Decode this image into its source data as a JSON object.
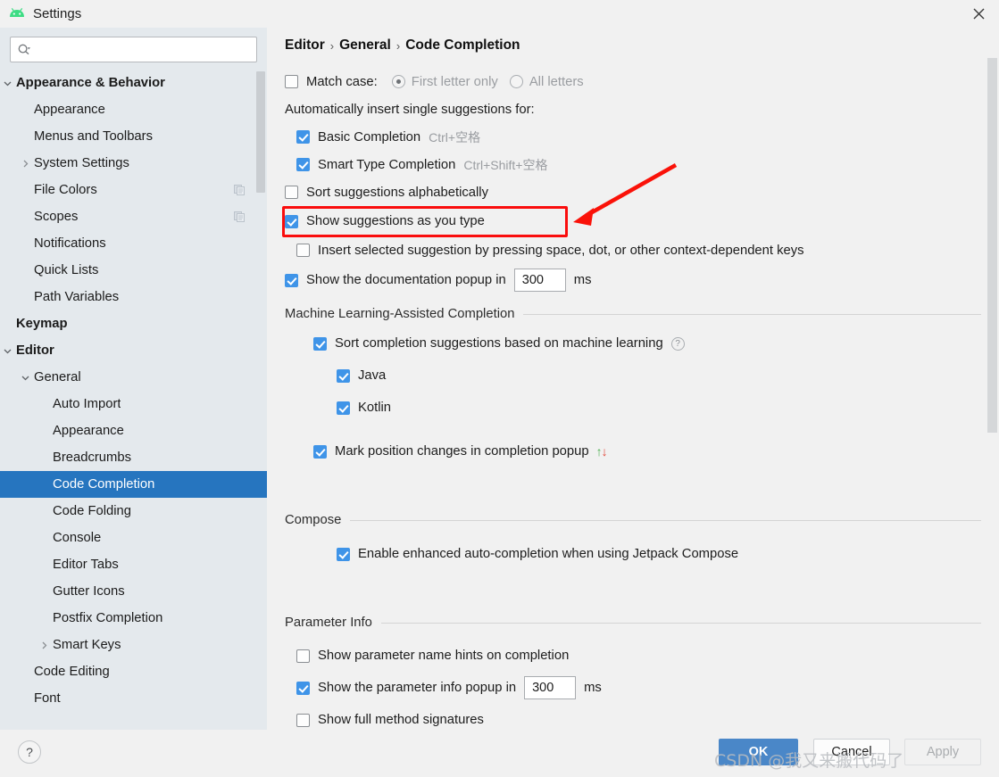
{
  "window": {
    "title": "Settings",
    "app_icon": "android-studio-icon",
    "close_icon": "close-icon"
  },
  "sidebar": {
    "search": {
      "value": "",
      "placeholder": "",
      "icon": "search-icon"
    },
    "items": [
      {
        "label": "Appearance & Behavior",
        "indent": 0,
        "bold": true,
        "twisty": "chevron-down",
        "selected": false,
        "trailing": ""
      },
      {
        "label": "Appearance",
        "indent": 1,
        "bold": false,
        "twisty": "",
        "selected": false,
        "trailing": ""
      },
      {
        "label": "Menus and Toolbars",
        "indent": 1,
        "bold": false,
        "twisty": "",
        "selected": false,
        "trailing": ""
      },
      {
        "label": "System Settings",
        "indent": 1,
        "bold": false,
        "twisty": "chevron-right",
        "selected": false,
        "trailing": ""
      },
      {
        "label": "File Colors",
        "indent": 1,
        "bold": false,
        "twisty": "",
        "selected": false,
        "trailing": "copy-icon"
      },
      {
        "label": "Scopes",
        "indent": 1,
        "bold": false,
        "twisty": "",
        "selected": false,
        "trailing": "copy-icon"
      },
      {
        "label": "Notifications",
        "indent": 1,
        "bold": false,
        "twisty": "",
        "selected": false,
        "trailing": ""
      },
      {
        "label": "Quick Lists",
        "indent": 1,
        "bold": false,
        "twisty": "",
        "selected": false,
        "trailing": ""
      },
      {
        "label": "Path Variables",
        "indent": 1,
        "bold": false,
        "twisty": "",
        "selected": false,
        "trailing": ""
      },
      {
        "label": "Keymap",
        "indent": 0,
        "bold": true,
        "twisty": "",
        "selected": false,
        "trailing": ""
      },
      {
        "label": "Editor",
        "indent": 0,
        "bold": true,
        "twisty": "chevron-down",
        "selected": false,
        "trailing": ""
      },
      {
        "label": "General",
        "indent": 1,
        "bold": false,
        "twisty": "chevron-down",
        "selected": false,
        "trailing": ""
      },
      {
        "label": "Auto Import",
        "indent": 2,
        "bold": false,
        "twisty": "",
        "selected": false,
        "trailing": ""
      },
      {
        "label": "Appearance",
        "indent": 2,
        "bold": false,
        "twisty": "",
        "selected": false,
        "trailing": ""
      },
      {
        "label": "Breadcrumbs",
        "indent": 2,
        "bold": false,
        "twisty": "",
        "selected": false,
        "trailing": ""
      },
      {
        "label": "Code Completion",
        "indent": 2,
        "bold": false,
        "twisty": "",
        "selected": true,
        "trailing": ""
      },
      {
        "label": "Code Folding",
        "indent": 2,
        "bold": false,
        "twisty": "",
        "selected": false,
        "trailing": ""
      },
      {
        "label": "Console",
        "indent": 2,
        "bold": false,
        "twisty": "",
        "selected": false,
        "trailing": ""
      },
      {
        "label": "Editor Tabs",
        "indent": 2,
        "bold": false,
        "twisty": "",
        "selected": false,
        "trailing": ""
      },
      {
        "label": "Gutter Icons",
        "indent": 2,
        "bold": false,
        "twisty": "",
        "selected": false,
        "trailing": ""
      },
      {
        "label": "Postfix Completion",
        "indent": 2,
        "bold": false,
        "twisty": "",
        "selected": false,
        "trailing": ""
      },
      {
        "label": "Smart Keys",
        "indent": 2,
        "bold": false,
        "twisty": "chevron-right",
        "selected": false,
        "trailing": ""
      },
      {
        "label": "Code Editing",
        "indent": 1,
        "bold": false,
        "twisty": "",
        "selected": false,
        "trailing": ""
      },
      {
        "label": "Font",
        "indent": 1,
        "bold": false,
        "twisty": "",
        "selected": false,
        "trailing": ""
      }
    ]
  },
  "main": {
    "breadcrumb": {
      "part1": "Editor",
      "part2": "General",
      "part3": "Code Completion",
      "separator": "›"
    },
    "match_case": {
      "label": "Match case:",
      "checked": false,
      "options": [
        {
          "label": "First letter only",
          "selected": true
        },
        {
          "label": "All letters",
          "selected": false
        }
      ]
    },
    "auto_insert_header": "Automatically insert single suggestions for:",
    "auto_insert": [
      {
        "label": "Basic Completion",
        "shortcut": "Ctrl+空格",
        "checked": true
      },
      {
        "label": "Smart Type Completion",
        "shortcut": "Ctrl+Shift+空格",
        "checked": true
      }
    ],
    "sort_alphabetically": {
      "label": "Sort suggestions alphabetically",
      "checked": false
    },
    "show_as_you_type": {
      "label": "Show suggestions as you type",
      "checked": true
    },
    "insert_selected": {
      "label": "Insert selected suggestion by pressing space, dot, or other context-dependent keys",
      "checked": false
    },
    "doc_popup": {
      "label": "Show the documentation popup in",
      "checked": true,
      "value": "300",
      "unit": "ms"
    },
    "ml_section": {
      "title": "Machine Learning-Assisted Completion",
      "sort_ml": {
        "label": "Sort completion suggestions based on machine learning",
        "checked": true,
        "help_icon": "help-circle-icon"
      },
      "languages": [
        {
          "label": "Java",
          "checked": true
        },
        {
          "label": "Kotlin",
          "checked": true
        }
      ],
      "mark_position": {
        "label": "Mark position changes in completion popup",
        "checked": true,
        "up_arrow": "↑",
        "down_arrow": "↓",
        "up_color": "#4caf50",
        "down_color": "#e24a3c"
      }
    },
    "compose_section": {
      "title": "Compose",
      "enable_compose": {
        "label": "Enable enhanced auto-completion when using Jetpack Compose",
        "checked": true
      }
    },
    "parameter_info_section": {
      "title": "Parameter Info",
      "name_hints": {
        "label": "Show parameter name hints on completion",
        "checked": false
      },
      "popup_delay": {
        "label": "Show the parameter info popup in",
        "checked": true,
        "value": "300",
        "unit": "ms"
      },
      "full_signatures": {
        "label": "Show full method signatures",
        "checked": false
      }
    }
  },
  "annotation": {
    "highlight_color": "#fa0d0d",
    "arrow_color": "#fa1209"
  },
  "footer": {
    "help_label": "?",
    "ok_label": "OK",
    "cancel_label": "Cancel",
    "apply_label": "Apply",
    "apply_disabled": true,
    "watermark": "CSDN @我又来搬代码了"
  },
  "colors": {
    "selection_blue": "#2675bf",
    "checkbox_blue": "#3f94e8",
    "ok_button": "#4a87c8",
    "sidebar_bg": "#e4e9ed",
    "main_bg": "#f1f1f1"
  }
}
